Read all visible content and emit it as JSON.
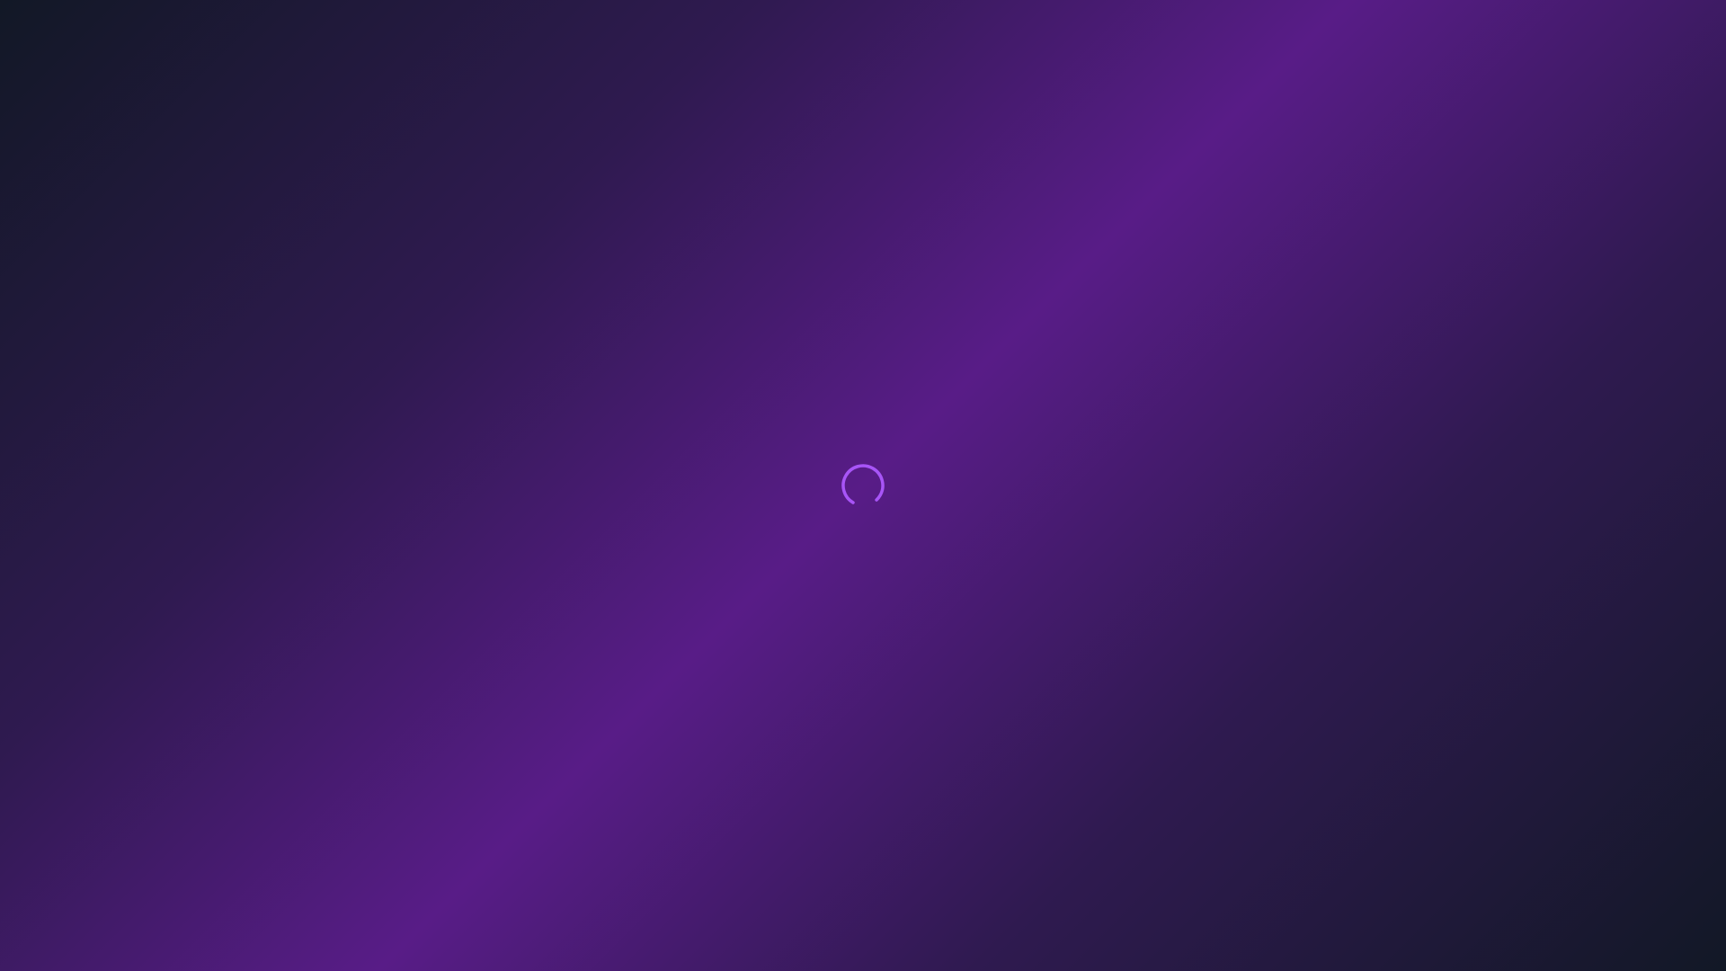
{
  "screen": {
    "state": "loading",
    "background_colors": [
      "#121826",
      "#2f1a50",
      "#581c87"
    ]
  },
  "loader": {
    "icon": "spinner-icon",
    "color": "#a855f7"
  }
}
